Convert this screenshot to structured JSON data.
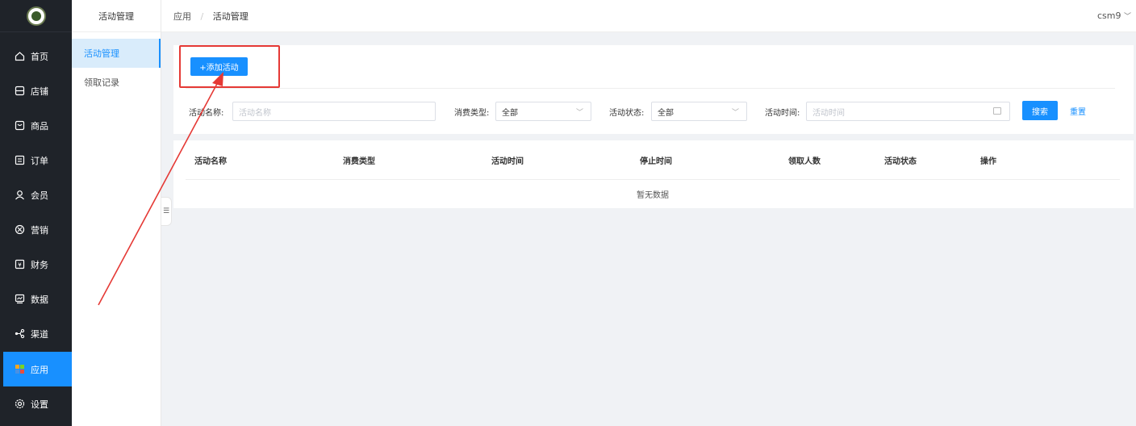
{
  "nav": {
    "items": [
      {
        "label": "首页",
        "icon": "home-icon"
      },
      {
        "label": "店铺",
        "icon": "store-icon"
      },
      {
        "label": "商品",
        "icon": "goods-icon"
      },
      {
        "label": "订单",
        "icon": "order-icon"
      },
      {
        "label": "会员",
        "icon": "member-icon"
      },
      {
        "label": "营销",
        "icon": "marketing-icon"
      },
      {
        "label": "财务",
        "icon": "finance-icon"
      },
      {
        "label": "数据",
        "icon": "data-icon"
      },
      {
        "label": "渠道",
        "icon": "channel-icon"
      },
      {
        "label": "应用",
        "icon": "app-icon"
      },
      {
        "label": "设置",
        "icon": "settings-icon"
      }
    ],
    "active": "应用"
  },
  "subnav": {
    "title": "活动管理",
    "items": [
      {
        "label": "活动管理"
      },
      {
        "label": "领取记录"
      }
    ]
  },
  "topbar": {
    "breadcrumb": [
      "应用",
      "活动管理"
    ],
    "user": "csm9"
  },
  "toolbar": {
    "add_label": "+添加活动"
  },
  "filters": {
    "name_label": "活动名称:",
    "name_placeholder": "活动名称",
    "type_label": "消费类型:",
    "type_value": "全部",
    "status_label": "活动状态:",
    "status_value": "全部",
    "time_label": "活动时间:",
    "time_placeholder": "活动时间",
    "search_label": "搜索",
    "reset_label": "重置"
  },
  "table": {
    "columns": [
      "活动名称",
      "消费类型",
      "活动时间",
      "停止时间",
      "领取人数",
      "活动状态",
      "操作"
    ],
    "empty_text": "暂无数据"
  },
  "colors": {
    "primary": "#1890ff",
    "nav_bg": "#1f2329",
    "annotation": "#e53935"
  }
}
